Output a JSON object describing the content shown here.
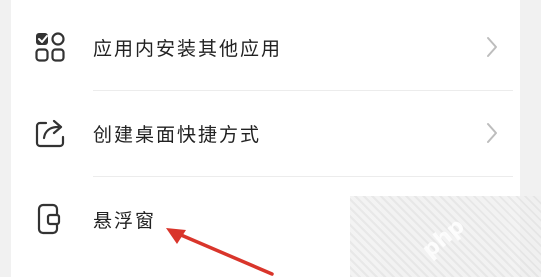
{
  "settings_list": {
    "items": [
      {
        "label": "应用内安装其他应用",
        "icon": "apps-grid-check-icon",
        "has_chevron": true
      },
      {
        "label": "创建桌面快捷方式",
        "icon": "shortcut-share-icon",
        "has_chevron": true
      },
      {
        "label": "悬浮窗",
        "icon": "floating-window-icon",
        "has_chevron": false
      }
    ]
  },
  "annotation": {
    "arrow_color": "#d9352b"
  },
  "watermark": {
    "text": "php"
  }
}
